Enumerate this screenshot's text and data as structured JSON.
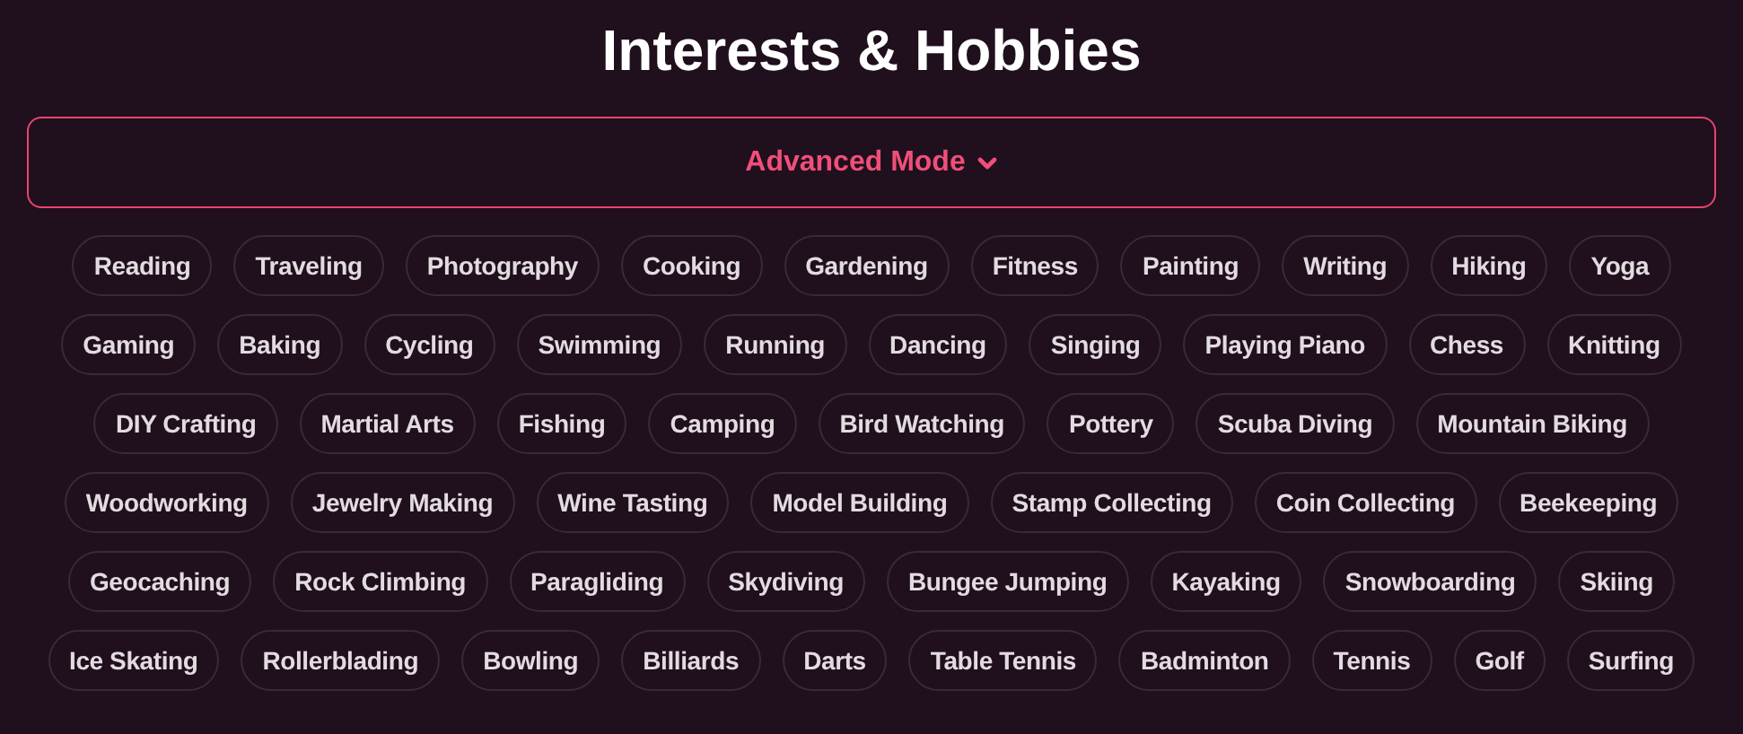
{
  "title": "Interests & Hobbies",
  "mode_toggle": {
    "label": "Advanced Mode",
    "expanded": false
  },
  "chip_rows": [
    [
      "Reading",
      "Traveling",
      "Photography",
      "Cooking",
      "Gardening",
      "Fitness",
      "Painting",
      "Writing",
      "Hiking",
      "Yoga"
    ],
    [
      "Gaming",
      "Baking",
      "Cycling",
      "Swimming",
      "Running",
      "Dancing",
      "Singing",
      "Playing Piano",
      "Chess",
      "Knitting"
    ],
    [
      "DIY Crafting",
      "Martial Arts",
      "Fishing",
      "Camping",
      "Bird Watching",
      "Pottery",
      "Scuba Diving",
      "Mountain Biking"
    ],
    [
      "Woodworking",
      "Jewelry Making",
      "Wine Tasting",
      "Model Building",
      "Stamp Collecting",
      "Coin Collecting",
      "Beekeeping"
    ],
    [
      "Geocaching",
      "Rock Climbing",
      "Paragliding",
      "Skydiving",
      "Bungee Jumping",
      "Kayaking",
      "Snowboarding",
      "Skiing"
    ],
    [
      "Ice Skating",
      "Rollerblading",
      "Bowling",
      "Billiards",
      "Darts",
      "Table Tennis",
      "Badminton",
      "Tennis",
      "Golf",
      "Surfing"
    ]
  ]
}
